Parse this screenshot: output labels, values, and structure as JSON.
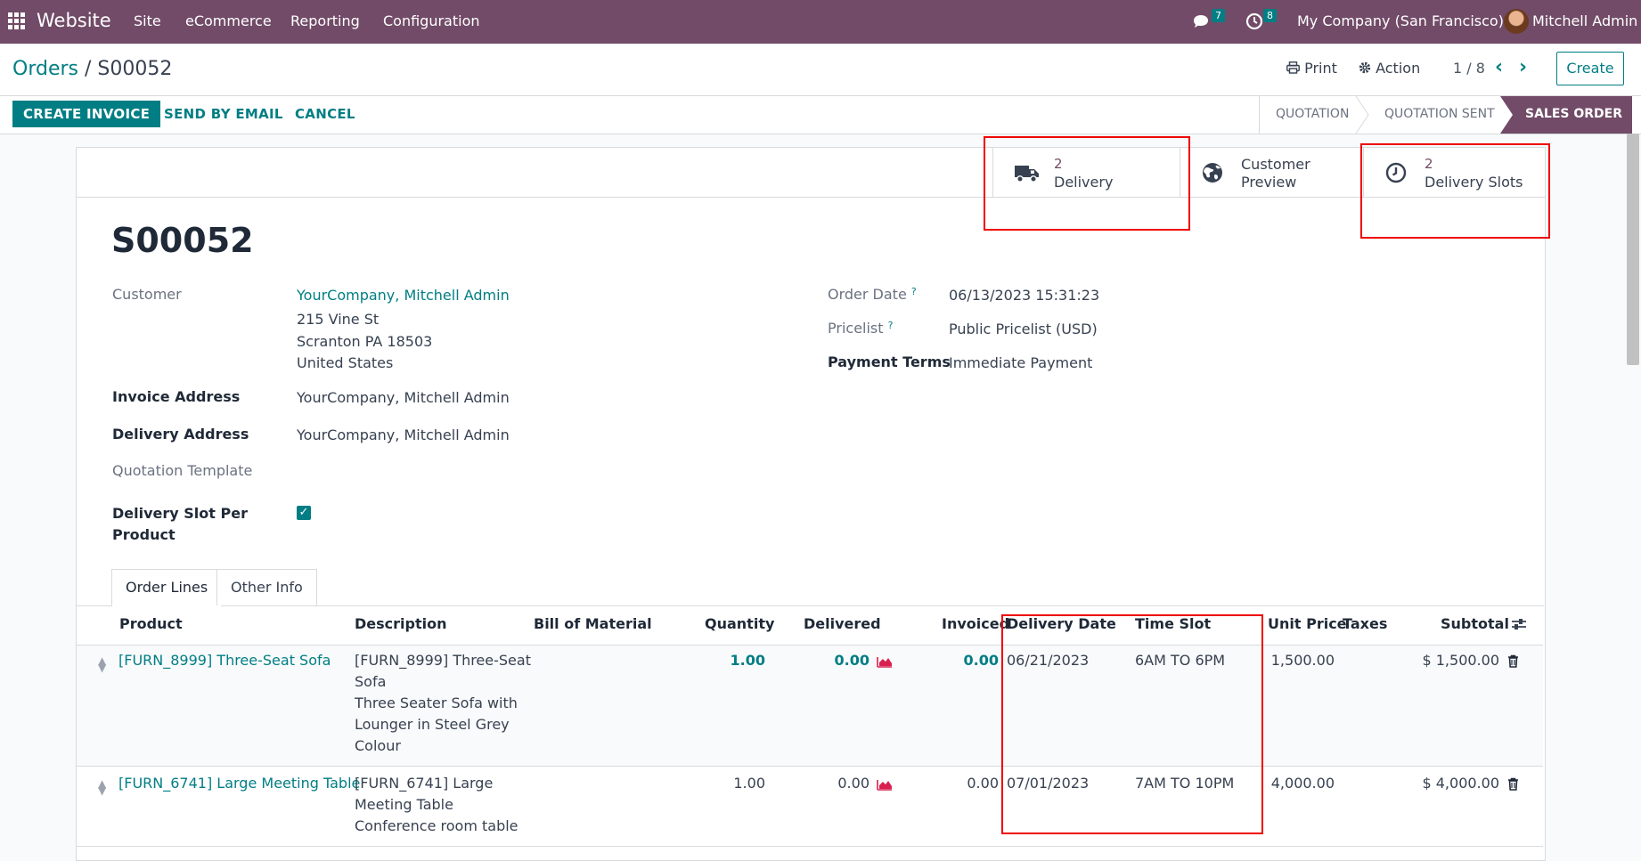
{
  "nav": {
    "app_name": "Website",
    "menu": [
      "Site",
      "eCommerce",
      "Reporting",
      "Configuration"
    ],
    "messages_count": "7",
    "activities_count": "8",
    "company": "My Company (San Francisco)",
    "user": "Mitchell Admin"
  },
  "control": {
    "breadcrumb_parent": "Orders",
    "breadcrumb_sep": "/",
    "breadcrumb_current": "S00052",
    "print_label": "Print",
    "action_label": "Action",
    "pager": "1 / 8",
    "create_label": "Create"
  },
  "statusbar": {
    "create_invoice": "CREATE INVOICE",
    "send_by_email": "SEND BY EMAIL",
    "cancel": "CANCEL",
    "stages": [
      "QUOTATION",
      "QUOTATION SENT",
      "SALES ORDER"
    ],
    "active_stage": "SALES ORDER"
  },
  "smart_buttons": {
    "delivery": {
      "value": "2",
      "label": "Delivery"
    },
    "customer_preview": {
      "label_line1": "Customer",
      "label_line2": "Preview"
    },
    "delivery_slots": {
      "value": "2",
      "label": "Delivery Slots"
    }
  },
  "record": {
    "name": "S00052",
    "customer_label": "Customer",
    "customer": "YourCompany, Mitchell Admin",
    "address_line1": "215 Vine St",
    "address_line2": "Scranton PA 18503",
    "address_line3": "United States",
    "invoice_address_label": "Invoice Address",
    "invoice_address": "YourCompany, Mitchell Admin",
    "delivery_address_label": "Delivery Address",
    "delivery_address": "YourCompany, Mitchell Admin",
    "quotation_template_label": "Quotation Template",
    "delivery_slot_label_line1": "Delivery Slot Per",
    "delivery_slot_label_line2": "Product",
    "order_date_label": "Order Date",
    "order_date": "06/13/2023 15:31:23",
    "pricelist_label": "Pricelist",
    "pricelist": "Public Pricelist (USD)",
    "payment_terms_label": "Payment Terms",
    "payment_terms": "Immediate Payment",
    "help_mark": "?"
  },
  "tabs": [
    "Order Lines",
    "Other Info"
  ],
  "table": {
    "headers": [
      "Product",
      "Description",
      "Bill of Material",
      "Quantity",
      "Delivered",
      "Invoiced",
      "Delivery Date",
      "Time Slot",
      "Unit Price",
      "Taxes",
      "Subtotal"
    ],
    "rows": [
      {
        "product": "[FURN_8999] Three-Seat Sofa",
        "description": [
          "[FURN_8999] Three-Seat",
          "Sofa",
          "Three Seater Sofa with",
          "Lounger in Steel Grey",
          "Colour"
        ],
        "quantity": "1.00",
        "delivered": "0.00",
        "invoiced": "0.00",
        "delivery_date": "06/21/2023",
        "time_slot": "6AM TO 6PM",
        "unit_price": "1,500.00",
        "subtotal": "$ 1,500.00"
      },
      {
        "product": "[FURN_6741] Large Meeting Table",
        "description": [
          "[FURN_6741] Large",
          "Meeting Table",
          "Conference room table"
        ],
        "quantity": "1.00",
        "delivered": "0.00",
        "invoiced": "0.00",
        "delivery_date": "07/01/2023",
        "time_slot": "7AM TO 10PM",
        "unit_price": "4,000.00",
        "subtotal": "$ 4,000.00"
      }
    ]
  },
  "icons": {
    "apps": "apps-grid-icon",
    "chat": "chat-icon",
    "clock": "clock-icon",
    "print": "print-icon",
    "gear": "gear-icon",
    "truck": "truck-icon",
    "globe": "globe-icon",
    "trash": "trash-icon",
    "chart": "area-chart-icon",
    "settings": "optional-columns-icon"
  },
  "colors": {
    "brand": "#714b67",
    "accent": "#017e84",
    "highlight": "#e00000"
  }
}
